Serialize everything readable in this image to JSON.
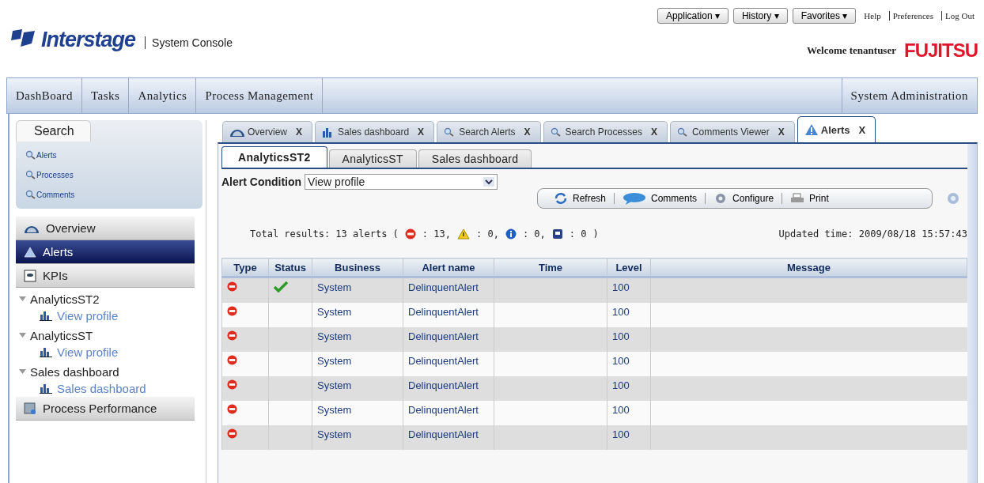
{
  "header": {
    "logo": "Interstage",
    "subtitle": "System Console",
    "menus": [
      {
        "label": "Application",
        "caret": "▾"
      },
      {
        "label": "History",
        "caret": "▾"
      },
      {
        "label": "Favorites",
        "caret": "▾"
      }
    ],
    "links": [
      "Help",
      "Preferences",
      "Log Out"
    ],
    "welcome": "Welcome tenantuser",
    "brand": "FUJITSU"
  },
  "nav": {
    "left": [
      "DashBoard",
      "Tasks",
      "Analytics",
      "Process Management"
    ],
    "right": [
      "System Administration"
    ]
  },
  "sidebar": {
    "search_tab": "Search",
    "search_links": [
      "Alerts",
      "Processes",
      "Comments"
    ],
    "sections": [
      {
        "kind": "nav",
        "label": "Overview",
        "selected": false
      },
      {
        "kind": "nav",
        "label": "Alerts",
        "selected": true
      },
      {
        "kind": "nav",
        "label": "KPIs",
        "selected": false
      },
      {
        "kind": "group",
        "label": "AnalyticsST2",
        "expanded": true,
        "children": [
          {
            "label": "View profile"
          }
        ]
      },
      {
        "kind": "group",
        "label": "AnalyticsST",
        "expanded": true,
        "children": [
          {
            "label": "View profile"
          }
        ]
      },
      {
        "kind": "group",
        "label": "Sales dashboard",
        "expanded": true,
        "children": [
          {
            "label": "Sales dashboard"
          }
        ]
      },
      {
        "kind": "nav",
        "label": "Process Performance",
        "selected": false
      }
    ]
  },
  "tabs": [
    {
      "label": "Overview",
      "close": "X",
      "selected": false
    },
    {
      "label": "Sales dashboard",
      "close": "X",
      "selected": false
    },
    {
      "label": "Search Alerts",
      "close": "X",
      "selected": false
    },
    {
      "label": "Search Processes",
      "close": "X",
      "selected": false
    },
    {
      "label": "Comments Viewer",
      "close": "X",
      "selected": false
    },
    {
      "label": "Alerts",
      "close": "X",
      "selected": true
    }
  ],
  "sub_tabs": [
    {
      "label": "AnalyticsST2",
      "selected": true
    },
    {
      "label": "AnalyticsST",
      "selected": false
    },
    {
      "label": "Sales dashboard",
      "selected": false
    }
  ],
  "alert_condition": {
    "label": "Alert Condition",
    "value": "View profile"
  },
  "toolbar": [
    "Refresh",
    "Comments",
    "Configure",
    "Print"
  ],
  "summary": {
    "prefix": "Total results: 13 alerts (",
    "counts": [
      {
        "kind": "error",
        "text": ": 13,"
      },
      {
        "kind": "warning",
        "text": ": 0,"
      },
      {
        "kind": "info",
        "text": ": 0,"
      },
      {
        "kind": "other",
        "text": ": 0"
      }
    ],
    "suffix": ")",
    "updated": "Updated time: 2009/08/18 15:57:43"
  },
  "table": {
    "columns": [
      "Type",
      "Status",
      "Business",
      "Alert name",
      "Time",
      "Level",
      "Message"
    ],
    "rows": [
      {
        "resolved": true,
        "business": "System",
        "alert_name": "DelinquentAlert",
        "level": "100"
      },
      {
        "resolved": false,
        "business": "System",
        "alert_name": "DelinquentAlert",
        "level": "100"
      },
      {
        "resolved": false,
        "business": "System",
        "alert_name": "DelinquentAlert",
        "level": "100"
      },
      {
        "resolved": false,
        "business": "System",
        "alert_name": "DelinquentAlert",
        "level": "100"
      },
      {
        "resolved": false,
        "business": "System",
        "alert_name": "DelinquentAlert",
        "level": "100"
      },
      {
        "resolved": false,
        "business": "System",
        "alert_name": "DelinquentAlert",
        "level": "100"
      },
      {
        "resolved": false,
        "business": "System",
        "alert_name": "DelinquentAlert",
        "level": "100"
      }
    ]
  }
}
